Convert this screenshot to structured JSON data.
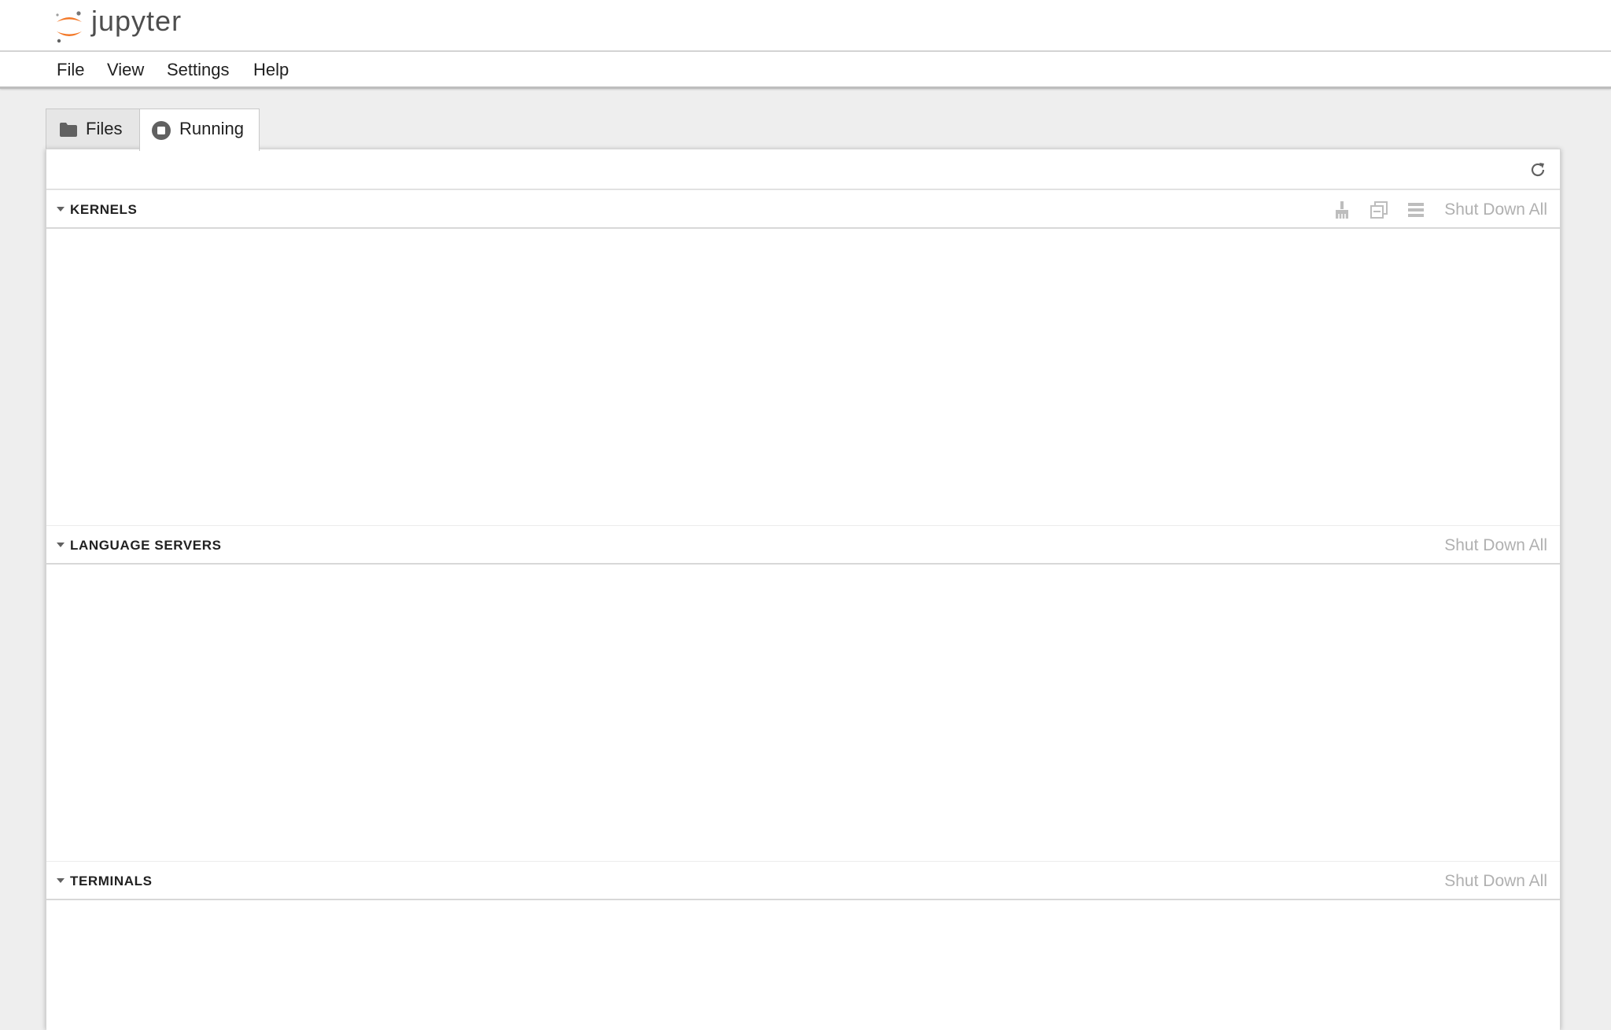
{
  "app": {
    "logo_text": "jupyter"
  },
  "menu": {
    "items": [
      "File",
      "View",
      "Settings",
      "Help"
    ]
  },
  "tabs": [
    {
      "label": "Files",
      "icon": "folder-icon"
    },
    {
      "label": "Running",
      "icon": "stop-circle-icon"
    }
  ],
  "toolbar": {
    "refresh_icon": "refresh-icon"
  },
  "sections": [
    {
      "title": "KERNELS",
      "action": "Shut Down All",
      "icons": [
        "cleaner-icon",
        "duplicate-icon",
        "list-view-icon"
      ]
    },
    {
      "title": "LANGUAGE SERVERS",
      "action": "Shut Down All"
    },
    {
      "title": "TERMINALS",
      "action": "Shut Down All"
    }
  ],
  "colors": {
    "accent": "#f37726",
    "disabled_text": "#b0b0b0",
    "background": "#eeeeee"
  }
}
